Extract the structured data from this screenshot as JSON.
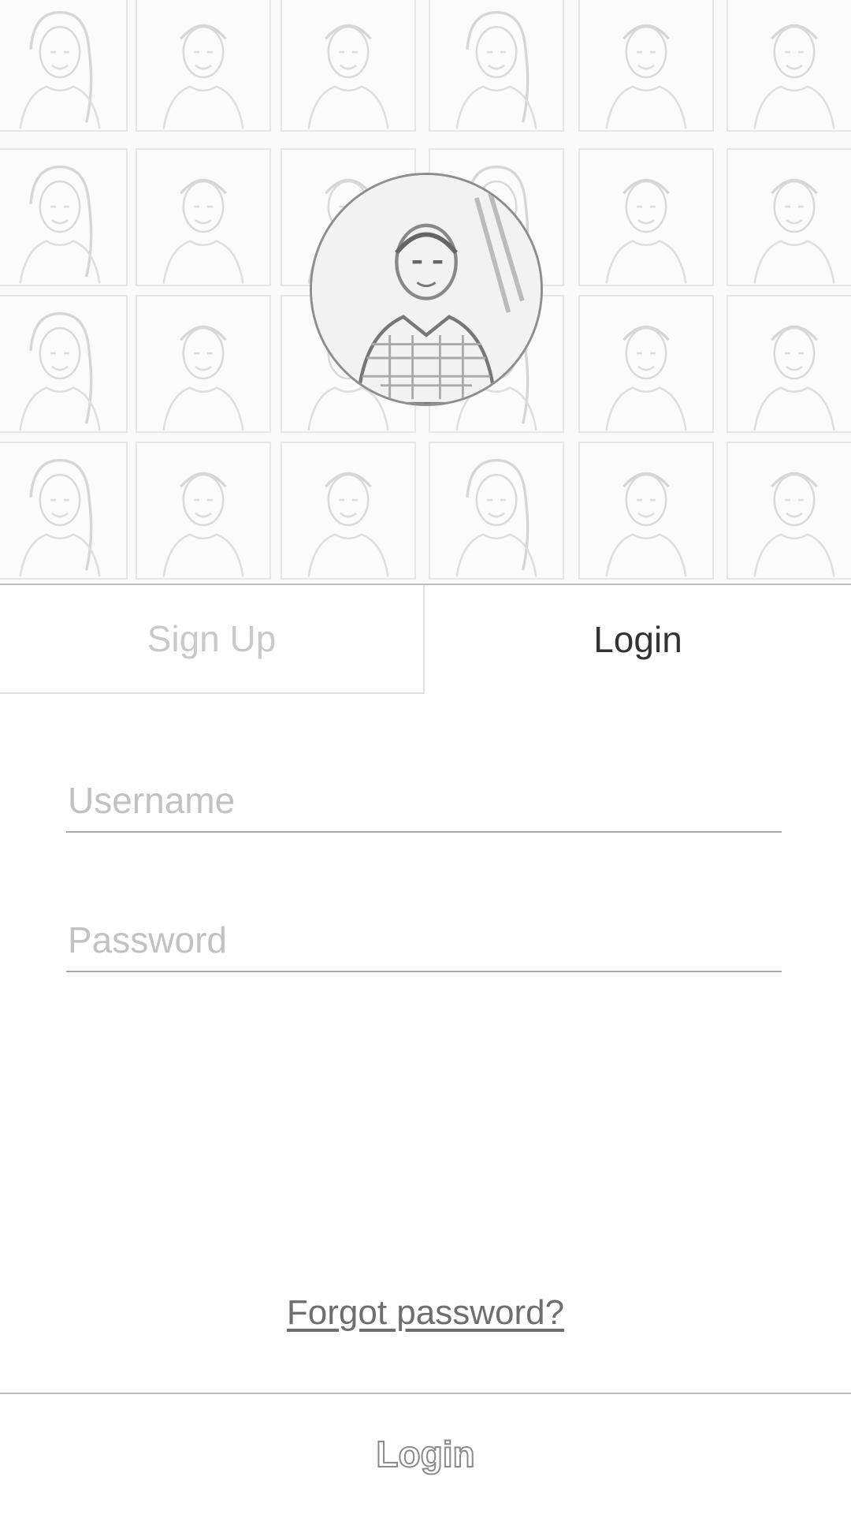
{
  "tabs": {
    "signup_label": "Sign Up",
    "login_label": "Login",
    "active": "login"
  },
  "form": {
    "username_placeholder": "Username",
    "password_placeholder": "Password"
  },
  "forgot_password_label": "Forgot password?",
  "login_button_label": "Login",
  "colors": {
    "inactive_tab_text": "#c9c9c9",
    "active_tab_text": "#333333",
    "divider": "#bdbdbd"
  },
  "icons": {
    "avatar": "profile-photo",
    "grid_tiles": "portrait-photo"
  }
}
